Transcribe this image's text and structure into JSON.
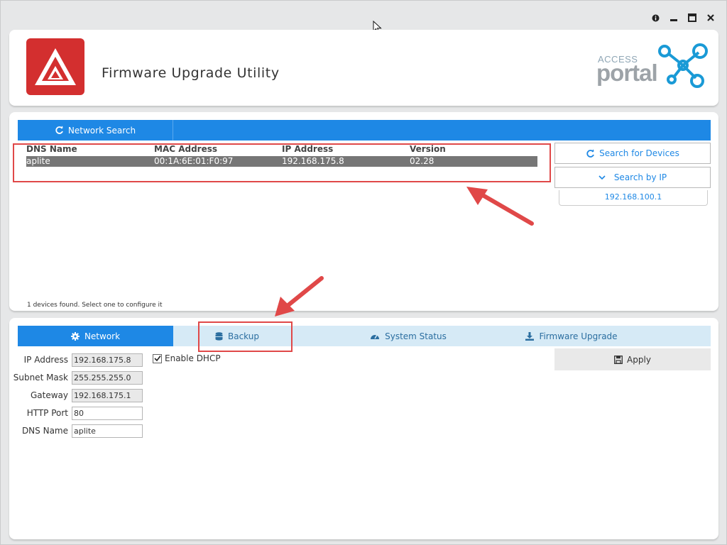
{
  "app": {
    "title": "Firmware Upgrade Utility",
    "brand_access": "ACCESS",
    "brand_portal": "portal"
  },
  "window_controls": {
    "info_icon": "info-icon",
    "minimize_icon": "minimize-icon",
    "maximize_icon": "maximize-icon",
    "close_icon": "close-icon"
  },
  "search": {
    "tab_label": "Network Search",
    "columns": [
      "DNS Name",
      "MAC Address",
      "IP Address",
      "Version"
    ],
    "rows": [
      {
        "dns": "aplite",
        "mac": "00:1A:6E:01:F0:97",
        "ip": "192.168.175.8",
        "version": "02.28"
      }
    ],
    "search_devices_label": "Search for Devices",
    "search_by_ip_label": "Search by IP",
    "search_ip_value": "192.168.100.1",
    "status_text": "1 devices found. Select one to configure it"
  },
  "settings": {
    "tabs": [
      {
        "label": "Network",
        "icon": "gear-icon"
      },
      {
        "label": "Backup",
        "icon": "database-icon"
      },
      {
        "label": "System Status",
        "icon": "dashboard-icon"
      },
      {
        "label": "Firmware Upgrade",
        "icon": "download-icon"
      }
    ],
    "fields": [
      {
        "label": "IP Address",
        "value": "192.168.175.8"
      },
      {
        "label": "Subnet Mask",
        "value": "255.255.255.0"
      },
      {
        "label": "Gateway",
        "value": "192.168.175.1"
      },
      {
        "label": "HTTP Port",
        "value": "80"
      },
      {
        "label": "DNS Name",
        "value": "aplite"
      }
    ],
    "dhcp_label": "Enable DHCP",
    "dhcp_checked": true,
    "apply_label": "Apply"
  },
  "colors": {
    "accent": "#1e88e5",
    "highlight": "#e04848",
    "logo_red": "#d32f2f"
  }
}
